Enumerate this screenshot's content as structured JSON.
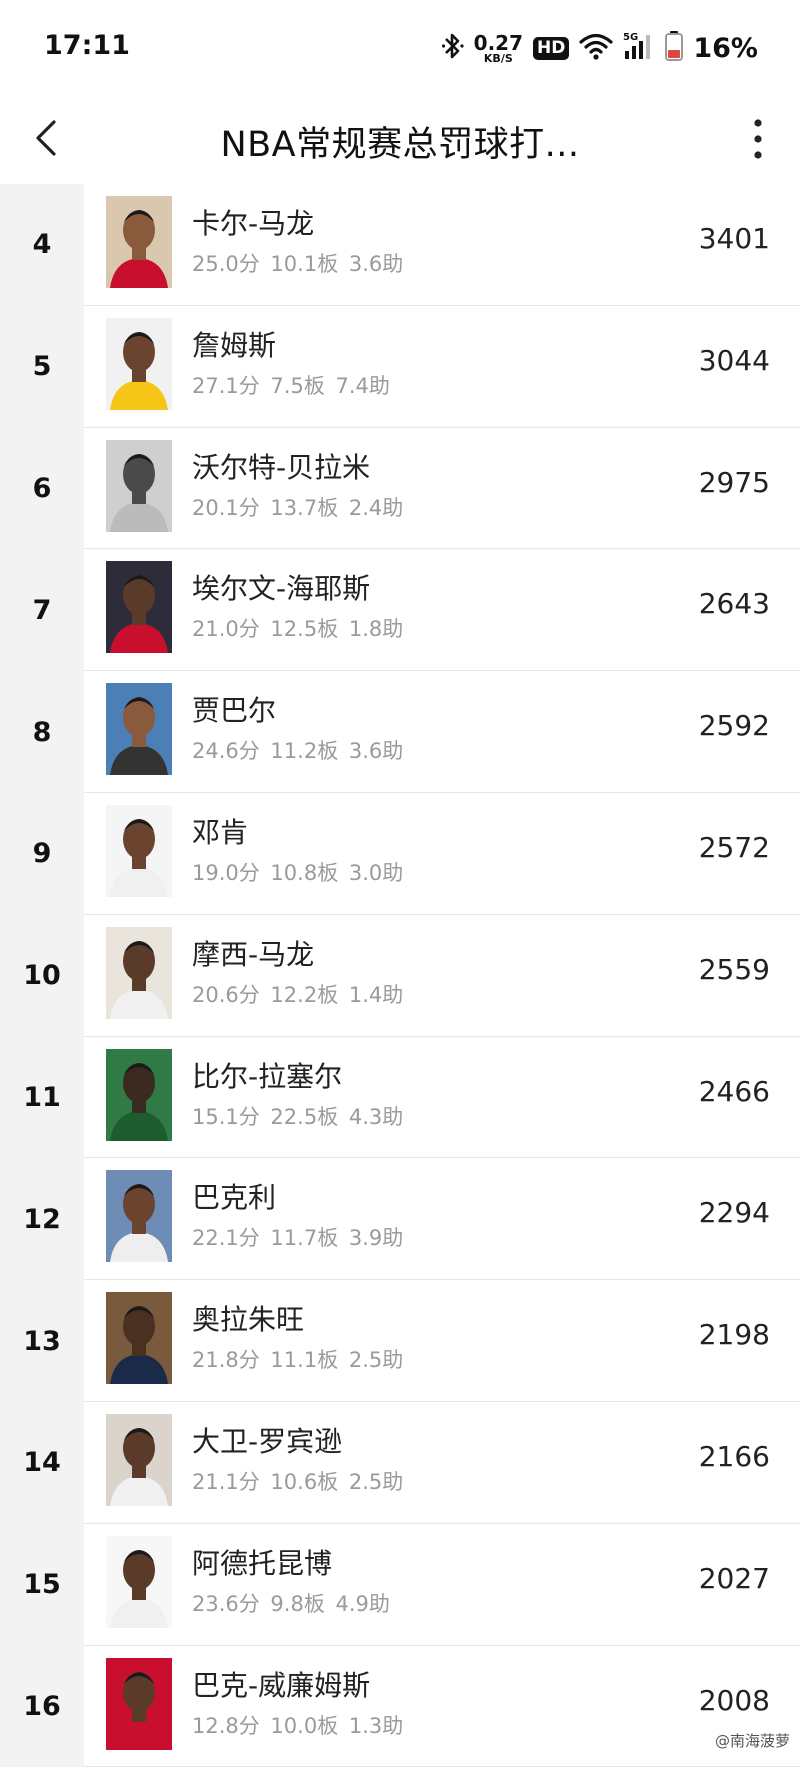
{
  "status": {
    "time": "17:11",
    "net_speed_value": "0.27",
    "net_speed_unit": "KB/S",
    "hd_badge": "HD",
    "network_type": "5G",
    "battery_pct": "16%",
    "battery_color": "#e0463c"
  },
  "header": {
    "title": "NBA常规赛总罚球打..."
  },
  "players": [
    {
      "rank": "4",
      "name": "卡尔-马龙",
      "stats": "25.0分 10.1板 3.6助",
      "value": "3401",
      "jersey": "#c8102e",
      "skin": "#8a5a3c",
      "bg": "#d9c7b0"
    },
    {
      "rank": "5",
      "name": "詹姆斯",
      "stats": "27.1分 7.5板 7.4助",
      "value": "3044",
      "jersey": "#f5c518",
      "skin": "#6b4430",
      "bg": "#f1f1f1"
    },
    {
      "rank": "6",
      "name": "沃尔特-贝拉米",
      "stats": "20.1分 13.7板 2.4助",
      "value": "2975",
      "jersey": "#bbbbbb",
      "skin": "#4a4a4a",
      "bg": "#cfcfcf"
    },
    {
      "rank": "7",
      "name": "埃尔文-海耶斯",
      "stats": "21.0分 12.5板 1.8助",
      "value": "2643",
      "jersey": "#c8102e",
      "skin": "#5a3a28",
      "bg": "#2c2c3a"
    },
    {
      "rank": "8",
      "name": "贾巴尔",
      "stats": "24.6分 11.2板 3.6助",
      "value": "2592",
      "jersey": "#333333",
      "skin": "#8a5a3c",
      "bg": "#4c7fb5"
    },
    {
      "rank": "9",
      "name": "邓肯",
      "stats": "19.0分 10.8板 3.0助",
      "value": "2572",
      "jersey": "#f0f0f0",
      "skin": "#6b4430",
      "bg": "#f5f5f5"
    },
    {
      "rank": "10",
      "name": "摩西-马龙",
      "stats": "20.6分 12.2板 1.4助",
      "value": "2559",
      "jersey": "#f0f0f0",
      "skin": "#5a3a28",
      "bg": "#e9e4dc"
    },
    {
      "rank": "11",
      "name": "比尔-拉塞尔",
      "stats": "15.1分 22.5板 4.3助",
      "value": "2466",
      "jersey": "#1d5c2e",
      "skin": "#3a2a20",
      "bg": "#2f7a45"
    },
    {
      "rank": "12",
      "name": "巴克利",
      "stats": "22.1分 11.7板 3.9助",
      "value": "2294",
      "jersey": "#eeeeee",
      "skin": "#6b4430",
      "bg": "#6d8db7"
    },
    {
      "rank": "13",
      "name": "奥拉朱旺",
      "stats": "21.8分 11.1板 2.5助",
      "value": "2198",
      "jersey": "#1c2a4a",
      "skin": "#4a3020",
      "bg": "#7a5a3c"
    },
    {
      "rank": "14",
      "name": "大卫-罗宾逊",
      "stats": "21.1分 10.6板 2.5助",
      "value": "2166",
      "jersey": "#f0f0f0",
      "skin": "#5a3a28",
      "bg": "#dad4cc"
    },
    {
      "rank": "15",
      "name": "阿德托昆博",
      "stats": "23.6分 9.8板 4.9助",
      "value": "2027",
      "jersey": "#f0f0f0",
      "skin": "#5a3a28",
      "bg": "#f7f7f7"
    },
    {
      "rank": "16",
      "name": "巴克-威廉姆斯",
      "stats": "12.8分 10.0板 1.3助",
      "value": "2008",
      "jersey": "#c8102e",
      "skin": "#5a3a28",
      "bg": "#c8102e"
    }
  ],
  "watermark": "@南海菠萝"
}
